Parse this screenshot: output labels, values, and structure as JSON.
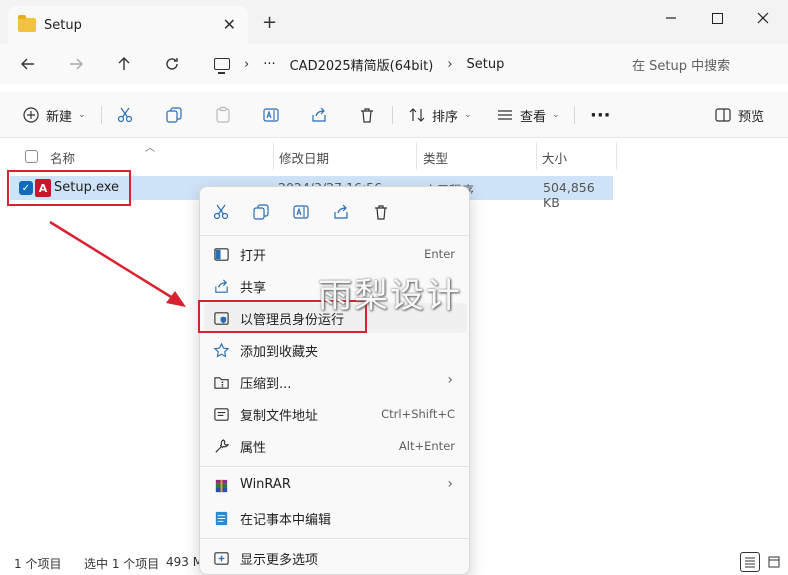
{
  "window": {
    "tab_title": "Setup",
    "tab_close": "✕",
    "new_tab": "+"
  },
  "nav": {
    "back_icon": "arrow-left",
    "forward_icon": "arrow-right",
    "up_icon": "arrow-up",
    "refresh_icon": "refresh"
  },
  "address": {
    "more": "···",
    "segments": [
      "CAD2025精简版(64bit)",
      "Setup"
    ],
    "chevron": "›"
  },
  "search": {
    "placeholder": "在 Setup 中搜索"
  },
  "toolbar": {
    "new_label": "新建",
    "sort_label": "排序",
    "view_label": "查看",
    "more": "···",
    "preview_label": "预览"
  },
  "columns": {
    "name": "名称",
    "modified": "修改日期",
    "type": "类型",
    "size": "大小"
  },
  "file": {
    "name": "Setup.exe",
    "modified": "2024/3/27 16:56",
    "type": "应用程序",
    "size": "504,856 KB"
  },
  "context_menu": {
    "items": [
      {
        "label": "打开",
        "shortcut": "Enter",
        "icon": "open-icon"
      },
      {
        "label": "共享",
        "shortcut": "",
        "icon": "share-icon"
      },
      {
        "label": "以管理员身份运行",
        "shortcut": "",
        "icon": "shield-icon"
      },
      {
        "label": "添加到收藏夹",
        "shortcut": "",
        "icon": "star-icon"
      },
      {
        "label": "压缩到...",
        "shortcut": "",
        "icon": "zip-folder-icon",
        "submenu": "›"
      },
      {
        "label": "复制文件地址",
        "shortcut": "Ctrl+Shift+C",
        "icon": "copy-path-icon"
      },
      {
        "label": "属性",
        "shortcut": "Alt+Enter",
        "icon": "wrench-icon"
      },
      {
        "label": "WinRAR",
        "shortcut": "",
        "icon": "winrar-icon",
        "submenu": "›"
      },
      {
        "label": "在记事本中编辑",
        "shortcut": "",
        "icon": "notepad-icon"
      },
      {
        "label": "显示更多选项",
        "shortcut": "",
        "icon": "more-options-icon"
      }
    ]
  },
  "status": {
    "item_count": "1 个项目",
    "selected": "选中 1 个项目",
    "size_partial": "493 M"
  },
  "watermark": "雨梨设计",
  "colors": {
    "accent": "#0f6cbd",
    "selection": "#cfe3f8",
    "highlight_red": "#d8222f",
    "folder": "#f3c23f"
  }
}
